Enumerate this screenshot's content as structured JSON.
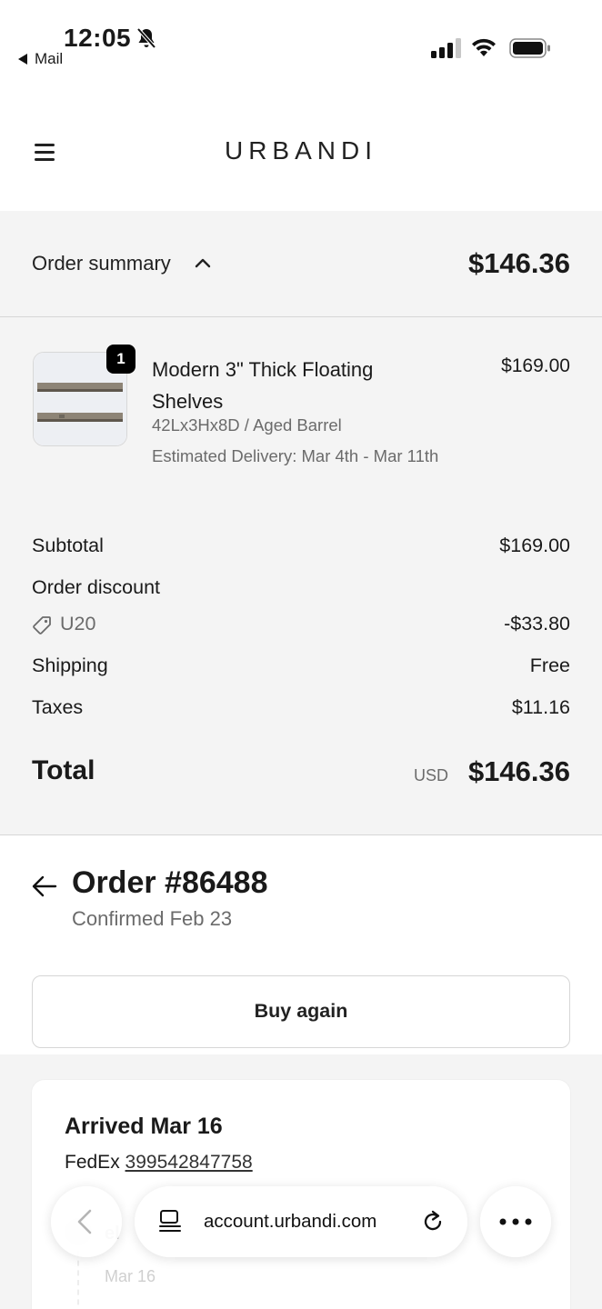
{
  "status_bar": {
    "time": "12:05",
    "back_app": "Mail"
  },
  "header": {
    "brand": "URBANDI"
  },
  "summary_bar": {
    "label": "Order summary",
    "total": "$146.36"
  },
  "line_item": {
    "quantity": "1",
    "name": "Modern 3\" Thick Floating Shelves",
    "variant": "42Lx3Hx8D / Aged Barrel",
    "delivery": "Estimated Delivery: Mar 4th - Mar 11th",
    "price": "$169.00"
  },
  "totals": {
    "subtotal_label": "Subtotal",
    "subtotal_value": "$169.00",
    "discount_label": "Order discount",
    "discount_code": "U20",
    "discount_value": "-$33.80",
    "shipping_label": "Shipping",
    "shipping_value": "Free",
    "taxes_label": "Taxes",
    "taxes_value": "$11.16",
    "total_label": "Total",
    "total_currency": "USD",
    "total_value": "$146.36"
  },
  "order": {
    "title": "Order #86488",
    "confirmed": "Confirmed Feb 23",
    "buy_again": "Buy again"
  },
  "shipment": {
    "status": "Arrived Mar 16",
    "carrier": "FedEx",
    "tracking_number": "399542847758",
    "timeline_partial_label": "el",
    "timeline_date": "Mar 16"
  },
  "browser": {
    "url": "account.urbandi.com"
  }
}
